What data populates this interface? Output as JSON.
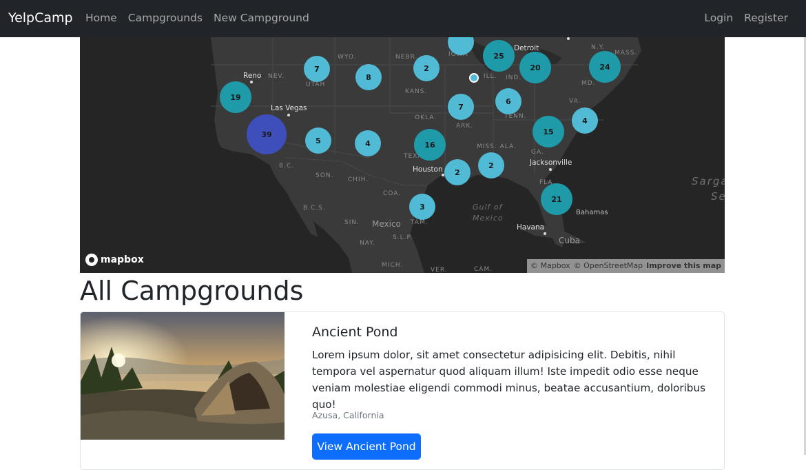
{
  "nav": {
    "brand": "YelpCamp",
    "links": [
      "Home",
      "Campgrounds",
      "New Campground"
    ],
    "auth": [
      "Login",
      "Register"
    ]
  },
  "map": {
    "clusters": [
      "19",
      "39",
      "7",
      "8",
      "2",
      "25",
      "20",
      "24",
      "7",
      "6",
      "5",
      "4",
      "16",
      "15",
      "4",
      "2",
      "2",
      "21",
      "3"
    ],
    "labels": {
      "wyo": "WYO.",
      "nebr": "NEBR.",
      "iowa": "IOWA",
      "detroit": "Detroit",
      "ny": "N.Y.",
      "mass": "MASS.",
      "reno": "Reno",
      "nev": "NEV.",
      "utah": "UTAH",
      "kans": "KANS.",
      "ill": "ILL.",
      "ind": "IND.",
      "md": "MD.",
      "va": "VA.",
      "lasvegas": "Las Vegas",
      "okla": "OKLA.",
      "ark": "ARK.",
      "tenn": "TENN.",
      "miss": "MISS. ALA.",
      "ga": "GA.",
      "tex": "TEXA",
      "bc": "B.C.",
      "son": "SON.",
      "chih": "CHIH.",
      "houston": "Houston",
      "jacksonville": "Jacksonville",
      "coa": "COA.",
      "fla": "FLA.",
      "bcs": "B.C.S.",
      "gulf1": "Gulf of",
      "gulf2": "Mexico",
      "bahamas": "Bahamas",
      "sin": "SIN.",
      "mexico": "Mexico",
      "tam": "TAM.",
      "slp": "S.L.P.",
      "havana": "Havana",
      "cuba": "Cuba",
      "nay": "NAY.",
      "mich": "MICH.",
      "ver": "VER.",
      "cam": "CAM.",
      "sarg": "Sarga",
      "se": "Se"
    },
    "logo": "mapbox",
    "attribution": {
      "mapbox": "© Mapbox",
      "osm": "© OpenStreetMap",
      "improve": "Improve this map"
    },
    "colors": {
      "small": "#51bbd6",
      "medium": "#1f9aa8",
      "large": "#3e4fbc"
    }
  },
  "main": {
    "title": "All Campgrounds",
    "campground": {
      "name": "Ancient Pond",
      "description": "Lorem ipsum dolor, sit amet consectetur adipisicing elit. Debitis, nihil tempora vel aspernatur quod aliquam illum! Iste impedit odio esse neque veniam molestiae eligendi commodi minus, beatae accusantium, doloribus quo!",
      "location": "Azusa, California",
      "button": "View Ancient Pond"
    }
  }
}
